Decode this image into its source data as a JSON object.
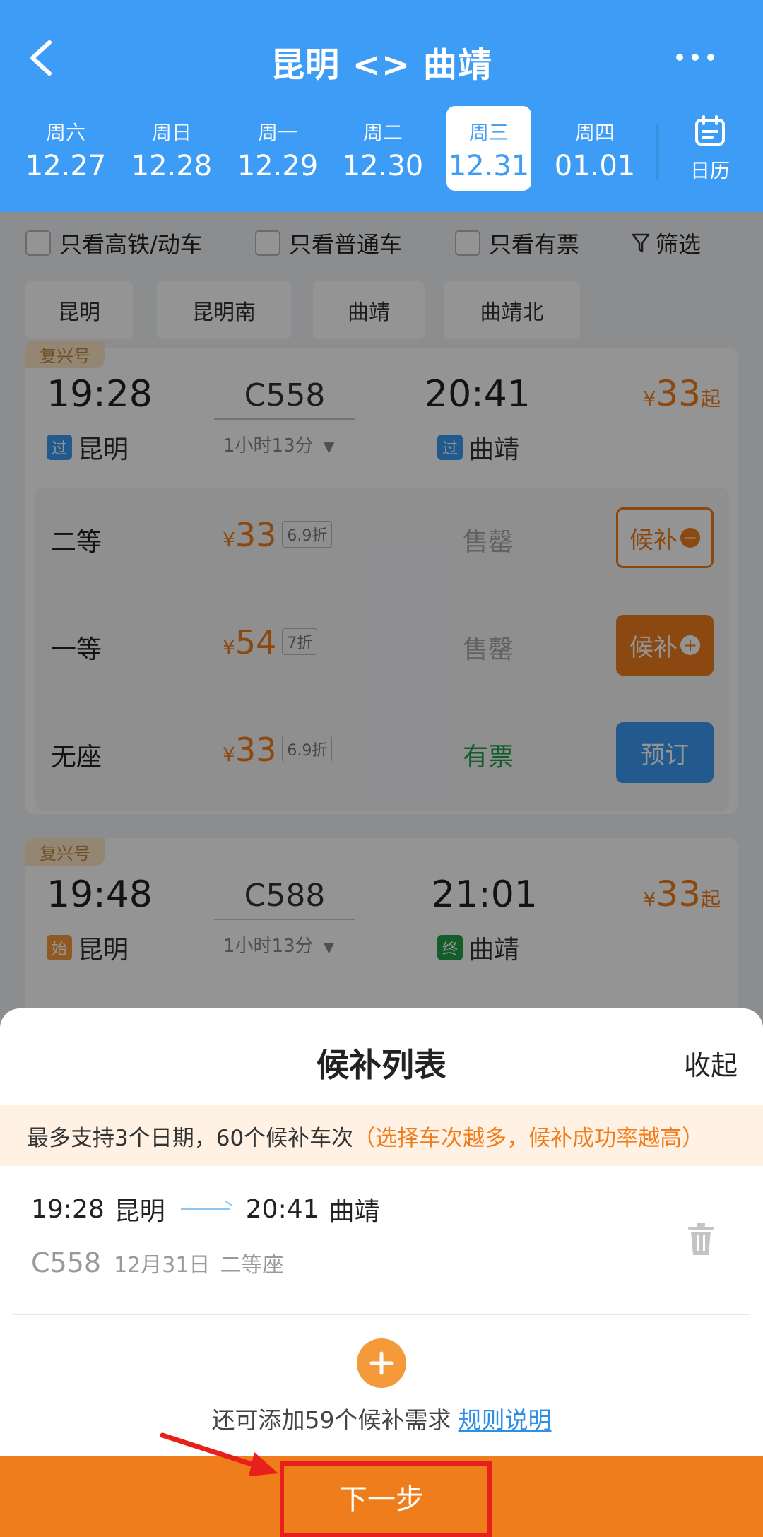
{
  "header": {
    "title": "昆明 <> 曲靖",
    "calendar_label": "日历",
    "dates": [
      {
        "weekday": "周六",
        "date": "12.27",
        "active": false
      },
      {
        "weekday": "周日",
        "date": "12.28",
        "active": false
      },
      {
        "weekday": "周一",
        "date": "12.29",
        "active": false
      },
      {
        "weekday": "周二",
        "date": "12.30",
        "active": false
      },
      {
        "weekday": "周三",
        "date": "12.31",
        "active": true
      },
      {
        "weekday": "周四",
        "date": "01.01",
        "active": false
      }
    ]
  },
  "filters": {
    "high_speed": "只看高铁/动车",
    "normal": "只看普通车",
    "available": "只看有票",
    "filter": "筛选"
  },
  "stations": [
    "昆明",
    "昆明南",
    "曲靖",
    "曲靖北"
  ],
  "trains": [
    {
      "tag": "复兴号",
      "depart_time": "19:28",
      "train_no": "C558",
      "arrive_time": "20:41",
      "duration": "1小时13分",
      "from_tag": "过",
      "from_station": "昆明",
      "to_tag": "过",
      "to_station": "曲靖",
      "price_symbol": "¥",
      "price": "33",
      "price_suffix": "起",
      "seats": [
        {
          "name": "二等",
          "symbol": "¥",
          "price": "33",
          "discount": "6.9折",
          "status": "售罄",
          "button": "候补",
          "button_mark": "−"
        },
        {
          "name": "一等",
          "symbol": "¥",
          "price": "54",
          "discount": "7折",
          "status": "售罄",
          "button": "候补",
          "button_mark": "+"
        },
        {
          "name": "无座",
          "symbol": "¥",
          "price": "33",
          "discount": "6.9折",
          "status": "有票",
          "button": "预订",
          "button_mark": ""
        }
      ]
    },
    {
      "tag": "复兴号",
      "depart_time": "19:48",
      "train_no": "C588",
      "arrive_time": "21:01",
      "duration": "1小时13分",
      "from_tag": "始",
      "from_station": "昆明",
      "to_tag": "终",
      "to_station": "曲靖",
      "price_symbol": "¥",
      "price": "33",
      "price_suffix": "起"
    }
  ],
  "sheet": {
    "title": "候补列表",
    "collapse": "收起",
    "notice_main": "最多支持3个日期，60个候补车次",
    "notice_hint": "（选择车次越多，候补成功率越高）",
    "item": {
      "depart_time": "19:28",
      "from": "昆明",
      "arrive_time": "20:41",
      "to": "曲靖",
      "train_no": "C558",
      "date": "12月31日",
      "seat": "二等座"
    },
    "add_text": "还可添加59个候补需求",
    "rules_link": "规则说明",
    "next_button": "下一步"
  },
  "colors": {
    "primary_blue": "#3d9cf5",
    "accent_orange": "#f07d1c",
    "available_green": "#24a14b",
    "highlight_red": "#e8201c"
  }
}
